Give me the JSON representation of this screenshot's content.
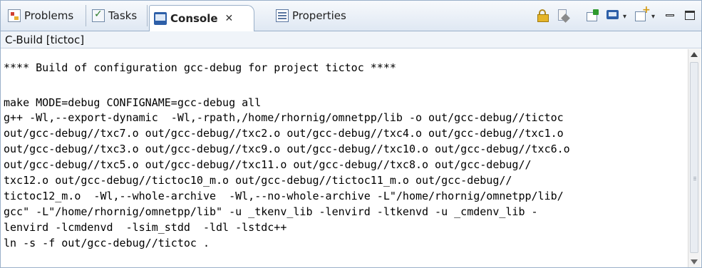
{
  "tabs": [
    {
      "label": "Problems",
      "icon": "problems-icon"
    },
    {
      "label": "Tasks",
      "icon": "tasks-icon"
    },
    {
      "label": "Console",
      "icon": "console-icon",
      "close": "✕"
    },
    {
      "label": "Properties",
      "icon": "properties-icon"
    }
  ],
  "toolbar": {
    "icons": [
      "scroll-lock-icon",
      "clear-console-icon",
      "pin-console-icon",
      "display-selected-console-icon",
      "open-console-icon",
      "minimize-icon",
      "maximize-icon"
    ]
  },
  "console": {
    "title": "C-Build [tictoc]",
    "lines": [
      "**** Build of configuration gcc-debug for project tictoc ****",
      "",
      "make MODE=debug CONFIGNAME=gcc-debug all",
      "g++ -Wl,--export-dynamic  -Wl,-rpath,/home/rhornig/omnetpp/lib -o out/gcc-debug//tictoc",
      "out/gcc-debug//txc7.o out/gcc-debug//txc2.o out/gcc-debug//txc4.o out/gcc-debug//txc1.o",
      "out/gcc-debug//txc3.o out/gcc-debug//txc9.o out/gcc-debug//txc10.o out/gcc-debug//txc6.o",
      "out/gcc-debug//txc5.o out/gcc-debug//txc11.o out/gcc-debug//txc8.o out/gcc-debug//",
      "txc12.o out/gcc-debug//tictoc10_m.o out/gcc-debug//tictoc11_m.o out/gcc-debug//",
      "tictoc12_m.o  -Wl,--whole-archive  -Wl,--no-whole-archive -L\"/home/rhornig/omnetpp/lib/",
      "gcc\" -L\"/home/rhornig/omnetpp/lib\" -u _tkenv_lib -lenvird -ltkenvd -u _cmdenv_lib -",
      "lenvird -lcmdenvd  -lsim_stdd  -ldl -lstdc++",
      "ln -s -f out/gcc-debug//tictoc ."
    ]
  }
}
